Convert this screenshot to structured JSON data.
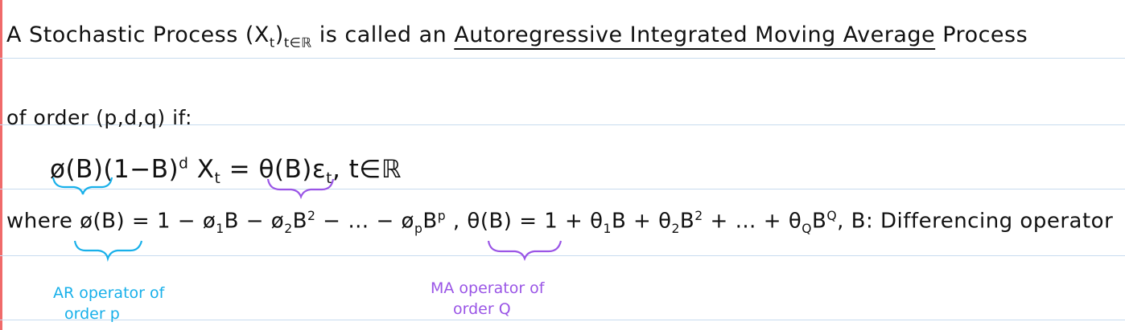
{
  "line1": {
    "part1": "A Stochastic Process (X",
    "sub": "t",
    "part2": ")",
    "index": "t∈ℝ",
    "part3": " is called an ",
    "term": "Autoregressive Integrated Moving Average",
    "part4": " Process"
  },
  "line2": {
    "text": "of order (p,d,q) if:"
  },
  "equation": {
    "phi_b": "ø(B)",
    "diff_term": "(1−B)",
    "diff_power": "d",
    "x_t": " X",
    "x_sub": "t",
    "equals": " = ",
    "theta_b": "θ(B)",
    "rhs": "ε",
    "rhs_sub": "t",
    "domain": ", t∈ℝ"
  },
  "where_line": {
    "where": "where ",
    "phi_def_lhs": "ø(B)",
    "phi_def_rhs_a": " = 1 − ø",
    "phi_sub1": "1",
    "phi_def_rhs_b": "B − ø",
    "phi_sub2": "2",
    "phi_def_rhs_c": "B",
    "phi_pow2": "2",
    "phi_def_rhs_d": " − … − ø",
    "phi_subp": "p",
    "phi_def_rhs_e": "B",
    "phi_powp": "p",
    "sep": "  ,  ",
    "theta_def_lhs": "θ(B)",
    "theta_def_rhs_a": " = 1 + θ",
    "theta_sub1": "1",
    "theta_def_rhs_b": "B + θ",
    "theta_sub2": "2",
    "theta_def_rhs_c": "B",
    "theta_pow2": "2",
    "theta_def_rhs_d": " + … + θ",
    "theta_subq": "Q",
    "theta_def_rhs_e": "B",
    "theta_powq": "Q",
    "b_def": ",  B: Differencing operator"
  },
  "notes": {
    "ar_line1": "AR operator of",
    "ar_line2": "order p",
    "ma_line1": "MA operator of",
    "ma_line2": "order Q"
  },
  "colors": {
    "ink": "#111111",
    "ar_blue": "#18b0ea",
    "ma_purple": "#9a55e6",
    "rule": "#c7dbef",
    "margin": "#f06a6a"
  }
}
